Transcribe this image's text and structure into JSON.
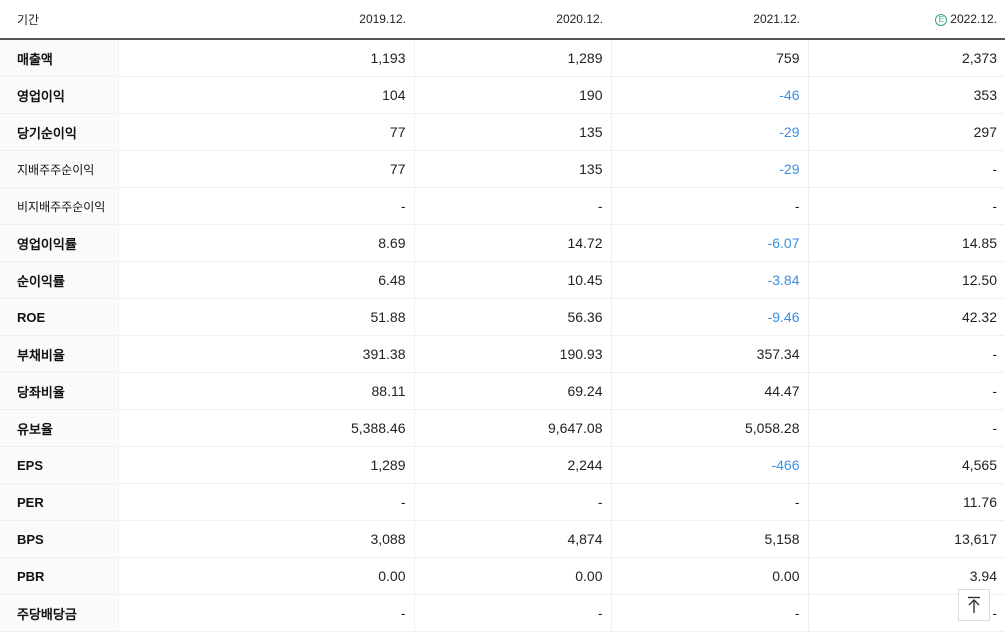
{
  "header": {
    "label": "기간",
    "years": [
      "2019.12.",
      "2020.12.",
      "2021.12.",
      "2022.12."
    ],
    "estimate_badge": "E"
  },
  "rows": [
    {
      "label": "매출액",
      "values": [
        "1,193",
        "1,289",
        "759",
        "2,373"
      ]
    },
    {
      "label": "영업이익",
      "values": [
        "104",
        "190",
        "-46",
        "353"
      ]
    },
    {
      "label": "당기순이익",
      "values": [
        "77",
        "135",
        "-29",
        "297"
      ]
    },
    {
      "label": "지배주주순이익",
      "values": [
        "77",
        "135",
        "-29",
        "-"
      ]
    },
    {
      "label": "비지배주주순이익",
      "values": [
        "-",
        "-",
        "-",
        "-"
      ]
    },
    {
      "label": "영업이익률",
      "values": [
        "8.69",
        "14.72",
        "-6.07",
        "14.85"
      ]
    },
    {
      "label": "순이익률",
      "values": [
        "6.48",
        "10.45",
        "-3.84",
        "12.50"
      ]
    },
    {
      "label": "ROE",
      "values": [
        "51.88",
        "56.36",
        "-9.46",
        "42.32"
      ]
    },
    {
      "label": "부채비율",
      "values": [
        "391.38",
        "190.93",
        "357.34",
        "-"
      ]
    },
    {
      "label": "당좌비율",
      "values": [
        "88.11",
        "69.24",
        "44.47",
        "-"
      ]
    },
    {
      "label": "유보율",
      "values": [
        "5,388.46",
        "9,647.08",
        "5,058.28",
        "-"
      ]
    },
    {
      "label": "EPS",
      "values": [
        "1,289",
        "2,244",
        "-466",
        "4,565"
      ]
    },
    {
      "label": "PER",
      "values": [
        "-",
        "-",
        "-",
        "11.76"
      ]
    },
    {
      "label": "BPS",
      "values": [
        "3,088",
        "4,874",
        "5,158",
        "13,617"
      ]
    },
    {
      "label": "PBR",
      "values": [
        "0.00",
        "0.00",
        "0.00",
        "3.94"
      ]
    },
    {
      "label": "주당배당금",
      "values": [
        "-",
        "-",
        "-",
        "-"
      ]
    }
  ],
  "colors": {
    "negative": "#3b8ee0",
    "estimate": "#2aa87b"
  },
  "scroll_top_icon": "arrow-up-icon"
}
